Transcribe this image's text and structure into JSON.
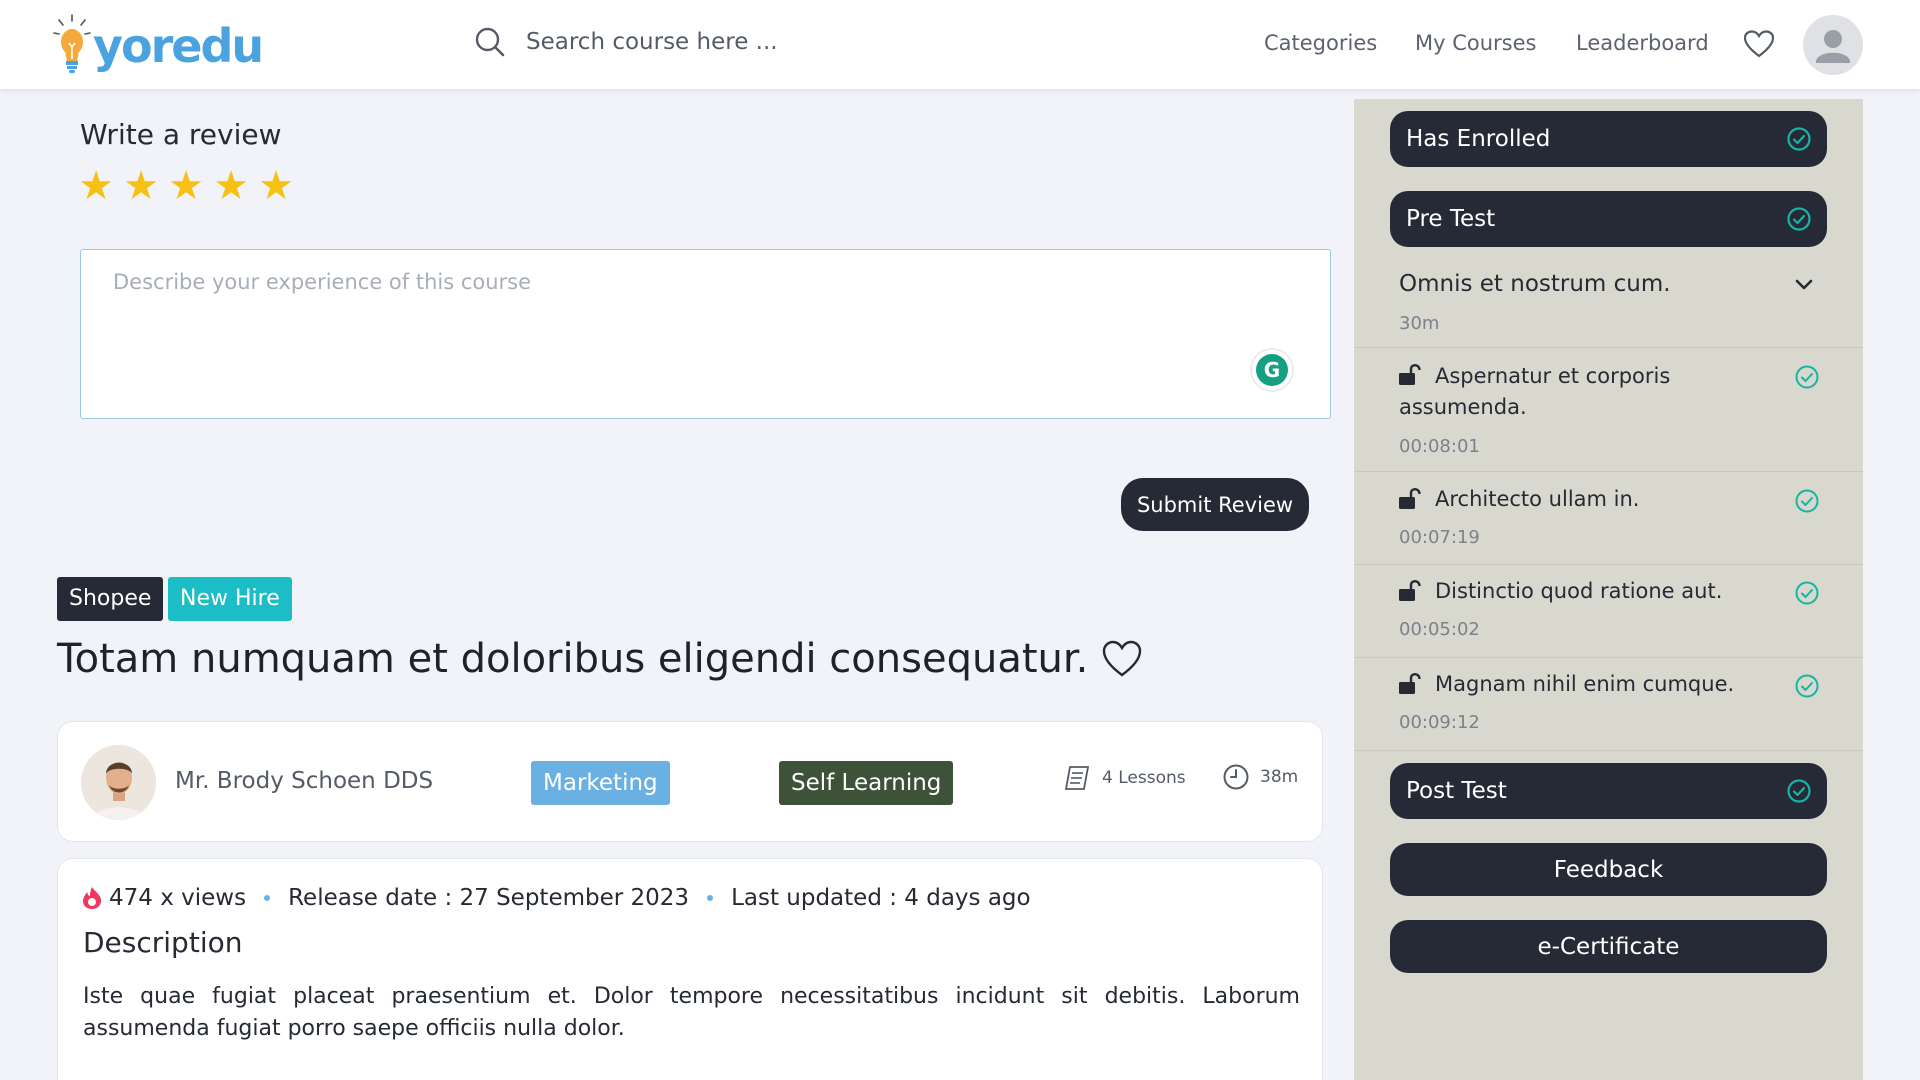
{
  "header": {
    "logo_text": "yoredu",
    "search_placeholder": "Search course here ...",
    "nav": [
      "Categories",
      "My Courses",
      "Leaderboard"
    ],
    "icons": [
      "lightbulb-logo-icon",
      "search-icon",
      "heart-icon",
      "user-avatar-icon"
    ]
  },
  "review": {
    "title": "Write a review",
    "rating": 5,
    "max_rating": 5,
    "stars": [
      "★",
      "★",
      "★",
      "★",
      "★"
    ],
    "placeholder": "Describe your experience of this course",
    "grammarly_letter": "G",
    "submit_label": "Submit Review"
  },
  "course": {
    "tags": [
      "Shopee",
      "New Hire"
    ],
    "title": "Totam numquam et doloribus eligendi consequatur.",
    "author": "Mr. Brody Schoen DDS",
    "category": "Marketing",
    "type": "Self Learning",
    "lessons": "4 Lessons",
    "duration": "38m",
    "views": "474 x views",
    "release": "Release date : 27 September 2023",
    "updated": "Last updated : 4 days ago",
    "description_title": "Description",
    "description": "Iste quae fugiat placeat praesentium et. Dolor tempore necessitatibus incidunt sit debitis. Laborum assumenda fugiat porro saepe officiis nulla dolor."
  },
  "sidebar": {
    "has_enrolled": "Has Enrolled",
    "pre_test": "Pre Test",
    "section_title": "Omnis et nostrum cum.",
    "section_duration": "30m",
    "lessons": [
      {
        "title": "Aspernatur et corporis assumenda.",
        "duration": "00:08:01"
      },
      {
        "title": "Architecto ullam in.",
        "duration": "00:07:19"
      },
      {
        "title": "Distinctio quod ratione aut.",
        "duration": "00:05:02"
      },
      {
        "title": "Magnam nihil enim cumque.",
        "duration": "00:09:12"
      }
    ],
    "post_test": "Post Test",
    "feedback": "Feedback",
    "certificate": "e-Certificate"
  },
  "colors": {
    "dark": "#262a36",
    "accent_blue": "#6ab0e2",
    "cyan": "#1bbec6",
    "green_chip": "#3d5238",
    "check_teal": "#17b3a3",
    "star": "#f7c114",
    "panel_bg": "#d8d8cf"
  }
}
